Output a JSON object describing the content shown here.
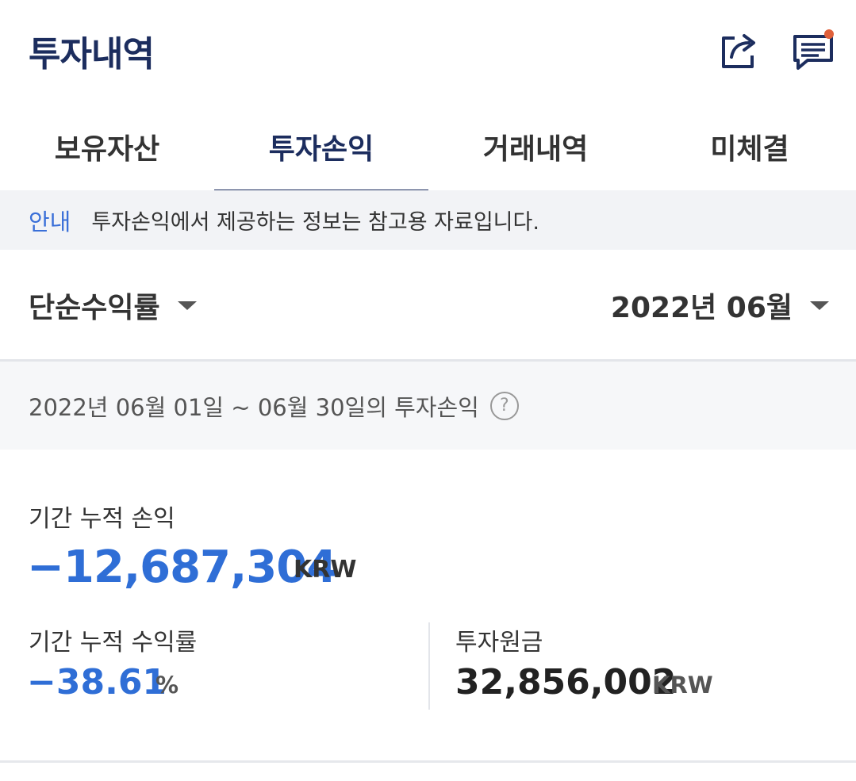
{
  "header": {
    "title": "투자내역",
    "icons": [
      "share-icon",
      "message-icon"
    ],
    "notification_dot_color": "#e0603a"
  },
  "tabs": [
    {
      "label": "보유자산",
      "active": false
    },
    {
      "label": "투자손익",
      "active": true
    },
    {
      "label": "거래내역",
      "active": false
    },
    {
      "label": "미체결",
      "active": false
    }
  ],
  "notice": {
    "tag": "안내",
    "text": "투자손익에서 제공하는 정보는 참고용 자료입니다."
  },
  "filters": {
    "return_type": "단순수익률",
    "month": "2022년 06월"
  },
  "period": {
    "text": "2022년 06월 01일 ~ 06월 30일의 투자손익",
    "help_icon": "?"
  },
  "summary": {
    "cum_pl_label": "기간 누적 손익",
    "cum_pl_value": "−12,687,304",
    "cum_pl_unit": "KRW",
    "cum_return_label": "기간 누적 수익률",
    "cum_return_value": "−38.61",
    "cum_return_unit": "%",
    "principal_label": "투자원금",
    "principal_value": "32,856,002",
    "principal_unit": "KRW"
  },
  "colors": {
    "brand_navy": "#1c2d5e",
    "loss_blue": "#2f6ed6",
    "notice_blue": "#3a6fd8"
  }
}
